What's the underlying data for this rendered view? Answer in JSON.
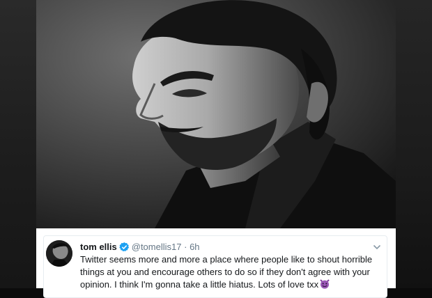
{
  "tweet": {
    "display_name": "tom ellis",
    "handle": "@tomellis17",
    "separator": "·",
    "time": "6h",
    "text": "Twitter seems more and more a place where people like to shout horrible things at you and encourage others to do so if they don't agree with your opinion. I think I'm gonna take a little hiatus. Lots of love txx",
    "emoji": "smiling-face-with-horns-icon"
  },
  "colors": {
    "text": "#14171a",
    "muted": "#657786",
    "verified": "#1da1f2",
    "emoji": "#9b59b6",
    "card_border": "#e6ecf0"
  }
}
